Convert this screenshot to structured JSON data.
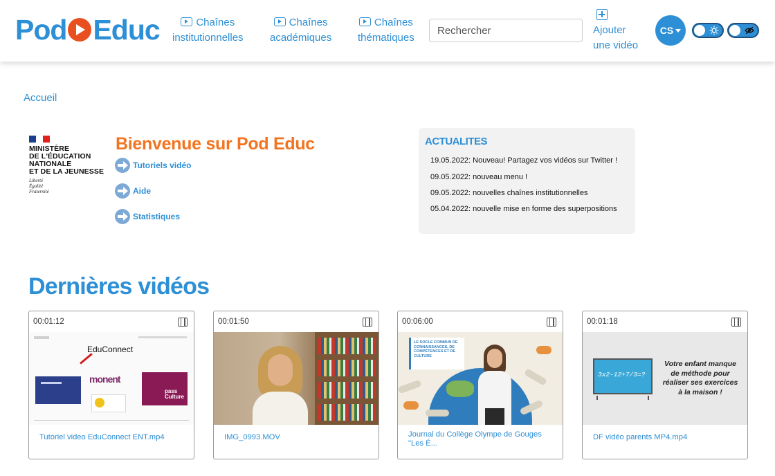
{
  "header": {
    "logo": {
      "part1": "Pod",
      "part2": "Educ"
    },
    "nav": [
      {
        "line1": "Chaînes",
        "line2": "institutionnelles"
      },
      {
        "line1": "Chaînes",
        "line2": "académiques"
      },
      {
        "line1": "Chaînes",
        "line2": "thématiques"
      }
    ],
    "search_placeholder": "Rechercher",
    "add_video": {
      "line1": "Ajouter",
      "line2": "une vidéo"
    },
    "user_initials": "CS"
  },
  "breadcrumb": "Accueil",
  "ministry": {
    "lines": [
      "MINISTÈRE",
      "DE L'ÉDUCATION",
      "NATIONALE",
      "ET DE LA JEUNESSE"
    ],
    "motto": [
      "Liberté",
      "Égalité",
      "Fraternité"
    ]
  },
  "welcome": {
    "title": "Bienvenue sur Pod Educ",
    "links": [
      "Tutoriels vidéo",
      "Aide",
      "Statistiques"
    ]
  },
  "news": {
    "title": "ACTUALITES",
    "items": [
      "19.05.2022: Nouveau! Partagez vos vidéos sur Twitter !",
      "09.05.2022: nouveau menu !",
      "09.05.2022: nouvelles chaînes institutionnelles",
      "05.04.2022: nouvelle mise en forme des superpositions"
    ]
  },
  "latest": {
    "title": "Dernières vidéos",
    "videos": [
      {
        "duration": "00:01:12",
        "title": "Tutoriel video EduConnect ENT.mp4"
      },
      {
        "duration": "00:01:50",
        "title": "IMG_0993.MOV"
      },
      {
        "duration": "00:06:00",
        "title": "Journal du Collège Olympe de Gouges \"Les É..."
      },
      {
        "duration": "00:01:18",
        "title": "DF vidéo parents MP4.mp4"
      }
    ],
    "thumb1": {
      "educonnect": "EduConnect",
      "monent": "monent",
      "pass": "pass Culture"
    },
    "thumb3": {
      "sign": "LE SOCLE COMMUN DE CONNAISSANCES, DE COMPÉTENCES ET DE CULTURE"
    },
    "thumb4": {
      "board": "3x2-12+7/3=?",
      "message": "Votre enfant manque de méthode pour réaliser ses exercices à la maison !"
    }
  },
  "colors": {
    "brand_blue": "#2d8fd5",
    "accent_orange": "#f27420",
    "logo_orange": "#e8501f"
  }
}
